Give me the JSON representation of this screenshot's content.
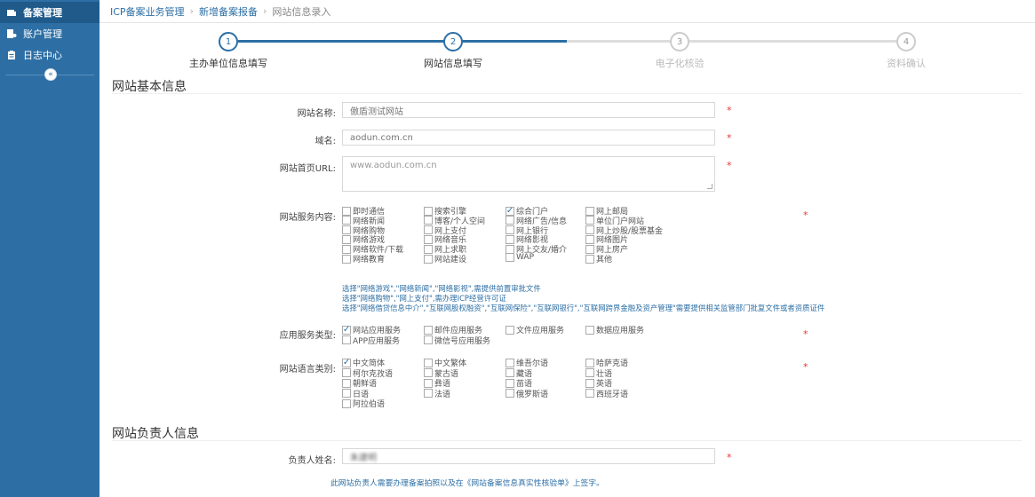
{
  "sidebar": {
    "items": [
      {
        "label": "备案管理",
        "icon": "folder-icon",
        "active": true
      },
      {
        "label": "账户管理",
        "icon": "user-file-icon",
        "active": false
      },
      {
        "label": "日志中心",
        "icon": "clipboard-icon",
        "active": false
      }
    ],
    "collapse_glyph": "«"
  },
  "breadcrumb": [
    "ICP备案业务管理",
    "新增备案报备",
    "网站信息录入"
  ],
  "steps": [
    {
      "num": "1",
      "label": "主办单位信息填写",
      "done": true
    },
    {
      "num": "2",
      "label": "网站信息填写",
      "done": true
    },
    {
      "num": "3",
      "label": "电子化核验",
      "done": false
    },
    {
      "num": "4",
      "label": "资料确认",
      "done": false
    }
  ],
  "basic": {
    "title": "网站基本信息",
    "name_label": "网站名称:",
    "name_value": "傲盾测试网站",
    "domain_label": "域名:",
    "domain_value": "aodun.com.cn",
    "url_label": "网站首页URL:",
    "url_value": "www.aodun.com.cn",
    "required_mark": "*",
    "service_label": "网站服务内容:",
    "service_options": [
      [
        "即时通信",
        "搜索引擎",
        "综合门户",
        "网上邮局"
      ],
      [
        "网络新闻",
        "博客/个人空间",
        "网络广告/信息",
        "单位门户网站"
      ],
      [
        "网络购物",
        "网上支付",
        "网上银行",
        "网上炒股/股票基金"
      ],
      [
        "网络游戏",
        "网络音乐",
        "网络影视",
        "网络图片"
      ],
      [
        "网络软件/下载",
        "网上求职",
        "网上交友/婚介",
        "网上房产"
      ],
      [
        "网络教育",
        "网站建设",
        "WAP",
        "其他"
      ]
    ],
    "hints": [
      "选择\"网络游戏\",\"网络新闻\",\"网络影视\",需提供前置审批文件",
      "选择\"网络购物\",\"网上支付\",需办理ICP经营许可证",
      "选择\"网络借贷信息中介\",\"互联网股权融资\",\"互联网保险\",\"互联网银行\",\"互联网跨界金融及资产管理\"需要提供相关监管部门批复文件或者资质证件"
    ],
    "app_type_label": "应用服务类型:",
    "app_types": [
      [
        "网站应用服务",
        "邮件应用服务",
        "文件应用服务",
        "数据应用服务"
      ],
      [
        "APP应用服务",
        "微信号应用服务"
      ]
    ],
    "lang_label": "网站语言类别:",
    "languages": [
      [
        "中文简体",
        "中文繁体",
        "维吾尔语",
        "哈萨克语"
      ],
      [
        "柯尔克孜语",
        "蒙古语",
        "藏语",
        "壮语"
      ],
      [
        "朝鲜语",
        "彝语",
        "苗语",
        "英语"
      ],
      [
        "日语",
        "法语",
        "俄罗斯语",
        "西班牙语"
      ],
      [
        "阿拉伯语"
      ]
    ]
  },
  "owner": {
    "title": "网站负责人信息",
    "name_label": "负责人姓名:",
    "name_value": "朱建明",
    "note": "此网站负责人需要办理备案拍照以及在《网站备案信息真实性核验单》上签字。"
  },
  "colors": {
    "accent": "#2d6fa5",
    "required": "#e33333"
  }
}
